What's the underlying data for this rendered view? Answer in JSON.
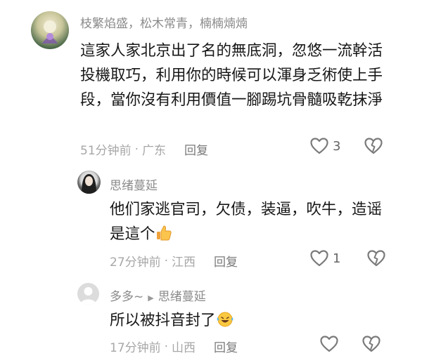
{
  "comments": [
    {
      "username": "枝繁焰盛，松木常青，楠楠煵煵",
      "text": "這家人家北京出了名的無底洞，忽悠一流幹活投機取巧，利用你的時候可以渾身乏術使上手段，當你沒有利用價值一腳踢坑骨髓吸乾抹淨",
      "time": "51分钟前",
      "location": "广东",
      "reply_label": "回复",
      "likes": "3"
    },
    {
      "username": "思绪蔓延",
      "text": "他们家逃官司，欠债，装逼，吹牛，造谣是這个",
      "emoji": "thumbs-up",
      "time": "27分钟前",
      "location": "江西",
      "reply_label": "回复",
      "likes": "1"
    },
    {
      "username": "多多~",
      "reply_to": "思绪蔓延",
      "text": "所以被抖音封了",
      "emoji": "laughing-crying",
      "time": "17分钟前",
      "location": "山西",
      "reply_label": "回复",
      "likes": ""
    }
  ],
  "separator": "·"
}
